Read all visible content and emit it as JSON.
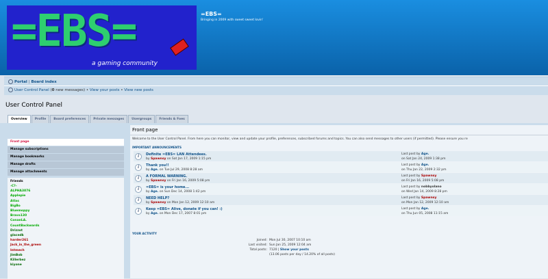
{
  "header": {
    "logo_text": "=EBS=",
    "logo_tagline": "a gaming community",
    "site_title": "=EBS=",
    "site_desc": "Bringing in 2009 with sweet sweet lovin'"
  },
  "nav": {
    "portal": "Portal",
    "sep": "|",
    "board_index": "Board index",
    "ucp": "User Control Panel",
    "new_messages_pre": "(",
    "new_messages_count": "0",
    "new_messages_post": " new messages)",
    "bullet": " • ",
    "view_posts": "View your posts",
    "view_posts2": "View new posts"
  },
  "page_title": "User Control Panel",
  "tabs": [
    "Overview",
    "Profile",
    "Board preferences",
    "Private messages",
    "Usergroups",
    "Friends & Foes"
  ],
  "sidebar": {
    "items": [
      "Front page",
      "Manage subscriptions",
      "Manage bookmarks",
      "Manage drafts",
      "Manage attachments"
    ],
    "friends_title": "Friends",
    "friends": [
      {
        "name": "-C?-",
        "color": "#00aa00"
      },
      {
        "name": "ALPHA3876",
        "color": "#00aa00"
      },
      {
        "name": "Applepie",
        "color": "#00aa00"
      },
      {
        "name": "Atlas",
        "color": "#00aa00"
      },
      {
        "name": "BigBo",
        "color": "#00aa00"
      },
      {
        "name": "Bluemoppy",
        "color": "#00aa00"
      },
      {
        "name": "Bravo130",
        "color": "#00aa00"
      },
      {
        "name": "ConanLA.",
        "color": "#00aa00"
      },
      {
        "name": "CountBackwards",
        "color": "#00aa00"
      },
      {
        "name": "Drizzot",
        "color": "#006600"
      },
      {
        "name": "glacedk",
        "color": "#006600"
      },
      {
        "name": "harder261",
        "color": "#aa0000"
      },
      {
        "name": "Jack_in_the_green",
        "color": "#aa0000"
      },
      {
        "name": "Intmech",
        "color": "#aa0000"
      },
      {
        "name": "JimBob",
        "color": "#006600"
      },
      {
        "name": "Killerbez",
        "color": "#006600"
      },
      {
        "name": "kiyone",
        "color": "#006600"
      }
    ]
  },
  "main": {
    "title": "Front page",
    "welcome": "Welcome to the User Control Panel. From here you can monitor, view and update your profile, preferences, subscribed forums and topics. You can also send messages to other users (if permitted). Please ensure you re",
    "announcements_header": "IMPORTANT ANNOUNCEMENTS",
    "topics": [
      {
        "title": "Definite =EBS= LAN Attendees.",
        "by": "by",
        "author": "Spawnsy",
        "date": "on Sat Jan 17, 2009 1:15 pm",
        "lp_label": "Last post by",
        "lp_author": "Age.",
        "lp_date": "on Sat Jan 24, 2009 1:38 pm"
      },
      {
        "title": "Thank you!!",
        "by": "by",
        "author": "Age.",
        "date": "on Tue Jul 29, 2008 8:28 am",
        "lp_label": "Last post by",
        "lp_author": "Age.",
        "lp_date": "on Thu Jan 22, 2009 2:32 pm"
      },
      {
        "title": "A FORMAL WARNING.",
        "by": "by",
        "author": "Spawnsy",
        "date": "on Fri Jan 16, 2009 5:08 pm",
        "lp_label": "Last post by",
        "lp_author": "Spawnsy",
        "lp_date": "on Fri Jan 16, 2009 5:08 pm"
      },
      {
        "title": "=EBS= is your home...",
        "by": "by",
        "author": "Age.",
        "date": "on Sun Dec 14, 2008 1:42 pm",
        "lp_label": "Last post by",
        "lp_author": "nobbyolano",
        "lp_date": "on Wed Jan 14, 2009 8:28 pm"
      },
      {
        "title": "NEED HELP?",
        "by": "by",
        "author": "Spawnsy",
        "date": "on Mon Jan 12, 2009 12:10 am",
        "lp_label": "Last post by",
        "lp_author": "Spawnsy",
        "lp_date": "on Mon Jan 12, 2009 12:10 am"
      },
      {
        "title": "Keep =EBS= Alive, donate if you can! :)",
        "by": "by",
        "author": "Age.",
        "date": "on Mon Dec 17, 2007 8:01 pm",
        "lp_label": "Last post by",
        "lp_author": "Age.",
        "lp_date": "on Thu Jun 05, 2008 11:15 am"
      }
    ],
    "activity_header": "YOUR ACTIVITY",
    "joined_label": "Joined:",
    "joined": "Mon Jul 30, 2007 10:10 am",
    "last_visited_label": "Last visited:",
    "last_visited": "Sun Jan 25, 2009 12:04 am",
    "total_posts_label": "Total posts:",
    "total_posts": "7120",
    "total_posts_sep": " | ",
    "show_posts": "Show your posts",
    "posts_detail": "(13.06 posts per day / 14.20% of all posts)"
  }
}
